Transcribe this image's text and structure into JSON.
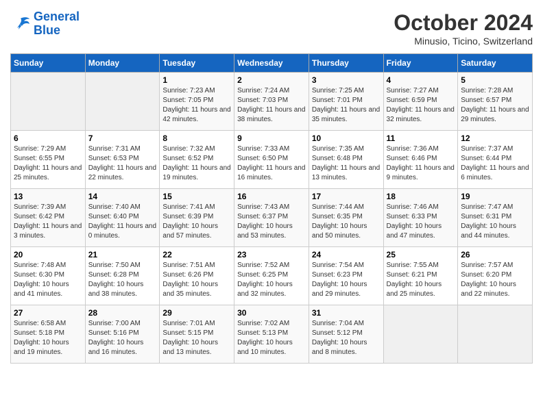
{
  "logo": {
    "line1": "General",
    "line2": "Blue"
  },
  "title": "October 2024",
  "location": "Minusio, Ticino, Switzerland",
  "days_of_week": [
    "Sunday",
    "Monday",
    "Tuesday",
    "Wednesday",
    "Thursday",
    "Friday",
    "Saturday"
  ],
  "weeks": [
    [
      {
        "day": "",
        "info": ""
      },
      {
        "day": "",
        "info": ""
      },
      {
        "day": "1",
        "info": "Sunrise: 7:23 AM\nSunset: 7:05 PM\nDaylight: 11 hours and 42 minutes."
      },
      {
        "day": "2",
        "info": "Sunrise: 7:24 AM\nSunset: 7:03 PM\nDaylight: 11 hours and 38 minutes."
      },
      {
        "day": "3",
        "info": "Sunrise: 7:25 AM\nSunset: 7:01 PM\nDaylight: 11 hours and 35 minutes."
      },
      {
        "day": "4",
        "info": "Sunrise: 7:27 AM\nSunset: 6:59 PM\nDaylight: 11 hours and 32 minutes."
      },
      {
        "day": "5",
        "info": "Sunrise: 7:28 AM\nSunset: 6:57 PM\nDaylight: 11 hours and 29 minutes."
      }
    ],
    [
      {
        "day": "6",
        "info": "Sunrise: 7:29 AM\nSunset: 6:55 PM\nDaylight: 11 hours and 25 minutes."
      },
      {
        "day": "7",
        "info": "Sunrise: 7:31 AM\nSunset: 6:53 PM\nDaylight: 11 hours and 22 minutes."
      },
      {
        "day": "8",
        "info": "Sunrise: 7:32 AM\nSunset: 6:52 PM\nDaylight: 11 hours and 19 minutes."
      },
      {
        "day": "9",
        "info": "Sunrise: 7:33 AM\nSunset: 6:50 PM\nDaylight: 11 hours and 16 minutes."
      },
      {
        "day": "10",
        "info": "Sunrise: 7:35 AM\nSunset: 6:48 PM\nDaylight: 11 hours and 13 minutes."
      },
      {
        "day": "11",
        "info": "Sunrise: 7:36 AM\nSunset: 6:46 PM\nDaylight: 11 hours and 9 minutes."
      },
      {
        "day": "12",
        "info": "Sunrise: 7:37 AM\nSunset: 6:44 PM\nDaylight: 11 hours and 6 minutes."
      }
    ],
    [
      {
        "day": "13",
        "info": "Sunrise: 7:39 AM\nSunset: 6:42 PM\nDaylight: 11 hours and 3 minutes."
      },
      {
        "day": "14",
        "info": "Sunrise: 7:40 AM\nSunset: 6:40 PM\nDaylight: 11 hours and 0 minutes."
      },
      {
        "day": "15",
        "info": "Sunrise: 7:41 AM\nSunset: 6:39 PM\nDaylight: 10 hours and 57 minutes."
      },
      {
        "day": "16",
        "info": "Sunrise: 7:43 AM\nSunset: 6:37 PM\nDaylight: 10 hours and 53 minutes."
      },
      {
        "day": "17",
        "info": "Sunrise: 7:44 AM\nSunset: 6:35 PM\nDaylight: 10 hours and 50 minutes."
      },
      {
        "day": "18",
        "info": "Sunrise: 7:46 AM\nSunset: 6:33 PM\nDaylight: 10 hours and 47 minutes."
      },
      {
        "day": "19",
        "info": "Sunrise: 7:47 AM\nSunset: 6:31 PM\nDaylight: 10 hours and 44 minutes."
      }
    ],
    [
      {
        "day": "20",
        "info": "Sunrise: 7:48 AM\nSunset: 6:30 PM\nDaylight: 10 hours and 41 minutes."
      },
      {
        "day": "21",
        "info": "Sunrise: 7:50 AM\nSunset: 6:28 PM\nDaylight: 10 hours and 38 minutes."
      },
      {
        "day": "22",
        "info": "Sunrise: 7:51 AM\nSunset: 6:26 PM\nDaylight: 10 hours and 35 minutes."
      },
      {
        "day": "23",
        "info": "Sunrise: 7:52 AM\nSunset: 6:25 PM\nDaylight: 10 hours and 32 minutes."
      },
      {
        "day": "24",
        "info": "Sunrise: 7:54 AM\nSunset: 6:23 PM\nDaylight: 10 hours and 29 minutes."
      },
      {
        "day": "25",
        "info": "Sunrise: 7:55 AM\nSunset: 6:21 PM\nDaylight: 10 hours and 25 minutes."
      },
      {
        "day": "26",
        "info": "Sunrise: 7:57 AM\nSunset: 6:20 PM\nDaylight: 10 hours and 22 minutes."
      }
    ],
    [
      {
        "day": "27",
        "info": "Sunrise: 6:58 AM\nSunset: 5:18 PM\nDaylight: 10 hours and 19 minutes."
      },
      {
        "day": "28",
        "info": "Sunrise: 7:00 AM\nSunset: 5:16 PM\nDaylight: 10 hours and 16 minutes."
      },
      {
        "day": "29",
        "info": "Sunrise: 7:01 AM\nSunset: 5:15 PM\nDaylight: 10 hours and 13 minutes."
      },
      {
        "day": "30",
        "info": "Sunrise: 7:02 AM\nSunset: 5:13 PM\nDaylight: 10 hours and 10 minutes."
      },
      {
        "day": "31",
        "info": "Sunrise: 7:04 AM\nSunset: 5:12 PM\nDaylight: 10 hours and 8 minutes."
      },
      {
        "day": "",
        "info": ""
      },
      {
        "day": "",
        "info": ""
      }
    ]
  ]
}
